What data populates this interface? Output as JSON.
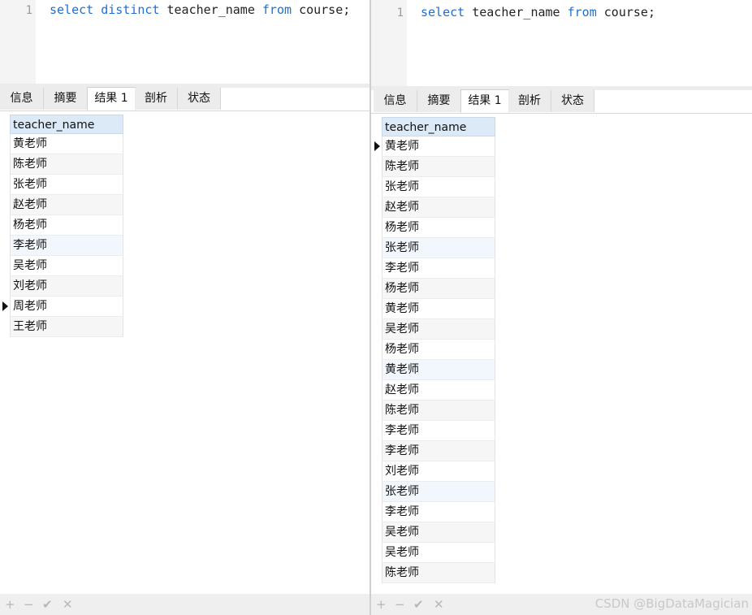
{
  "left": {
    "editor": {
      "line_number": "1",
      "kw1": "select",
      "kw2": "distinct",
      "mid": "teacher_name",
      "kw3": "from",
      "end": "course;"
    },
    "tabs": [
      "信息",
      "摘要",
      "结果 1",
      "剖析",
      "状态"
    ],
    "active_tab": "结果 1",
    "grid": {
      "header": "teacher_name",
      "rows": [
        "黄老师",
        "陈老师",
        "张老师",
        "赵老师",
        "杨老师",
        "李老师",
        "吴老师",
        "刘老师",
        "周老师",
        "王老师"
      ],
      "selected_row": 8
    },
    "footer": {
      "add": "+",
      "remove": "−",
      "apply": "✔",
      "cancel": "✕"
    }
  },
  "right": {
    "editor": {
      "line_number": "1",
      "kw1": "select",
      "mid": "teacher_name",
      "kw3": "from",
      "end": "course;"
    },
    "tabs": [
      "信息",
      "摘要",
      "结果 1",
      "剖析",
      "状态"
    ],
    "active_tab": "结果 1",
    "grid": {
      "header": "teacher_name",
      "rows": [
        "黄老师",
        "陈老师",
        "张老师",
        "赵老师",
        "杨老师",
        "张老师",
        "李老师",
        "杨老师",
        "黄老师",
        "吴老师",
        "杨老师",
        "黄老师",
        "赵老师",
        "陈老师",
        "李老师",
        "李老师",
        "刘老师",
        "张老师",
        "李老师",
        "吴老师",
        "吴老师",
        "陈老师"
      ],
      "selected_row": 0
    },
    "footer": {
      "add": "+",
      "remove": "−",
      "apply": "✔",
      "cancel": "✕"
    }
  },
  "watermark": "CSDN @BigDataMagician"
}
